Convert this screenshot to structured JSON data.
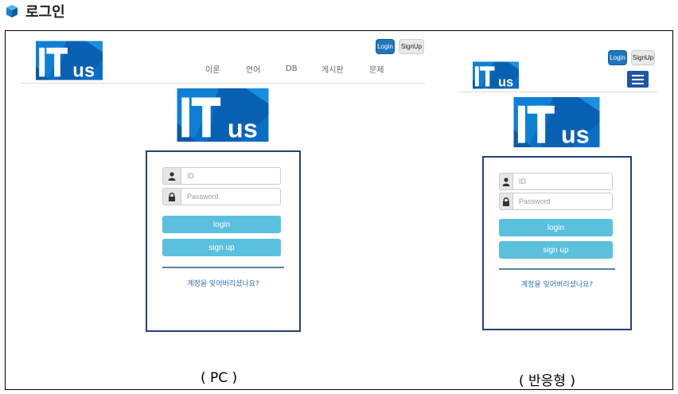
{
  "page": {
    "title": "로그인"
  },
  "pc": {
    "header_buttons": {
      "login": "Login",
      "signup": "SignUp"
    },
    "nav": [
      "이론",
      "언어",
      "DB",
      "게시판",
      "문제"
    ],
    "logo_text": "ITus",
    "form": {
      "id_placeholder": "ID",
      "password_placeholder": "Password",
      "login_label": "login",
      "signup_label": "sign up",
      "forgot_text": "계정을 잊어버리셨나요?"
    },
    "caption": "( PC )"
  },
  "responsive": {
    "header_buttons": {
      "login": "Login",
      "signup": "SignUp"
    },
    "logo_text": "ITus",
    "form": {
      "id_placeholder": "ID",
      "password_placeholder": "Password",
      "login_label": "login",
      "signup_label": "sign up",
      "forgot_text": "계정을 잊어버리셨나요?"
    },
    "caption": "( 반응형 )"
  },
  "colors": {
    "logo_blue": "#0b6cc4",
    "primary_button": "#1f76bd",
    "form_button": "#5bc0de",
    "box_border": "#25417a"
  }
}
